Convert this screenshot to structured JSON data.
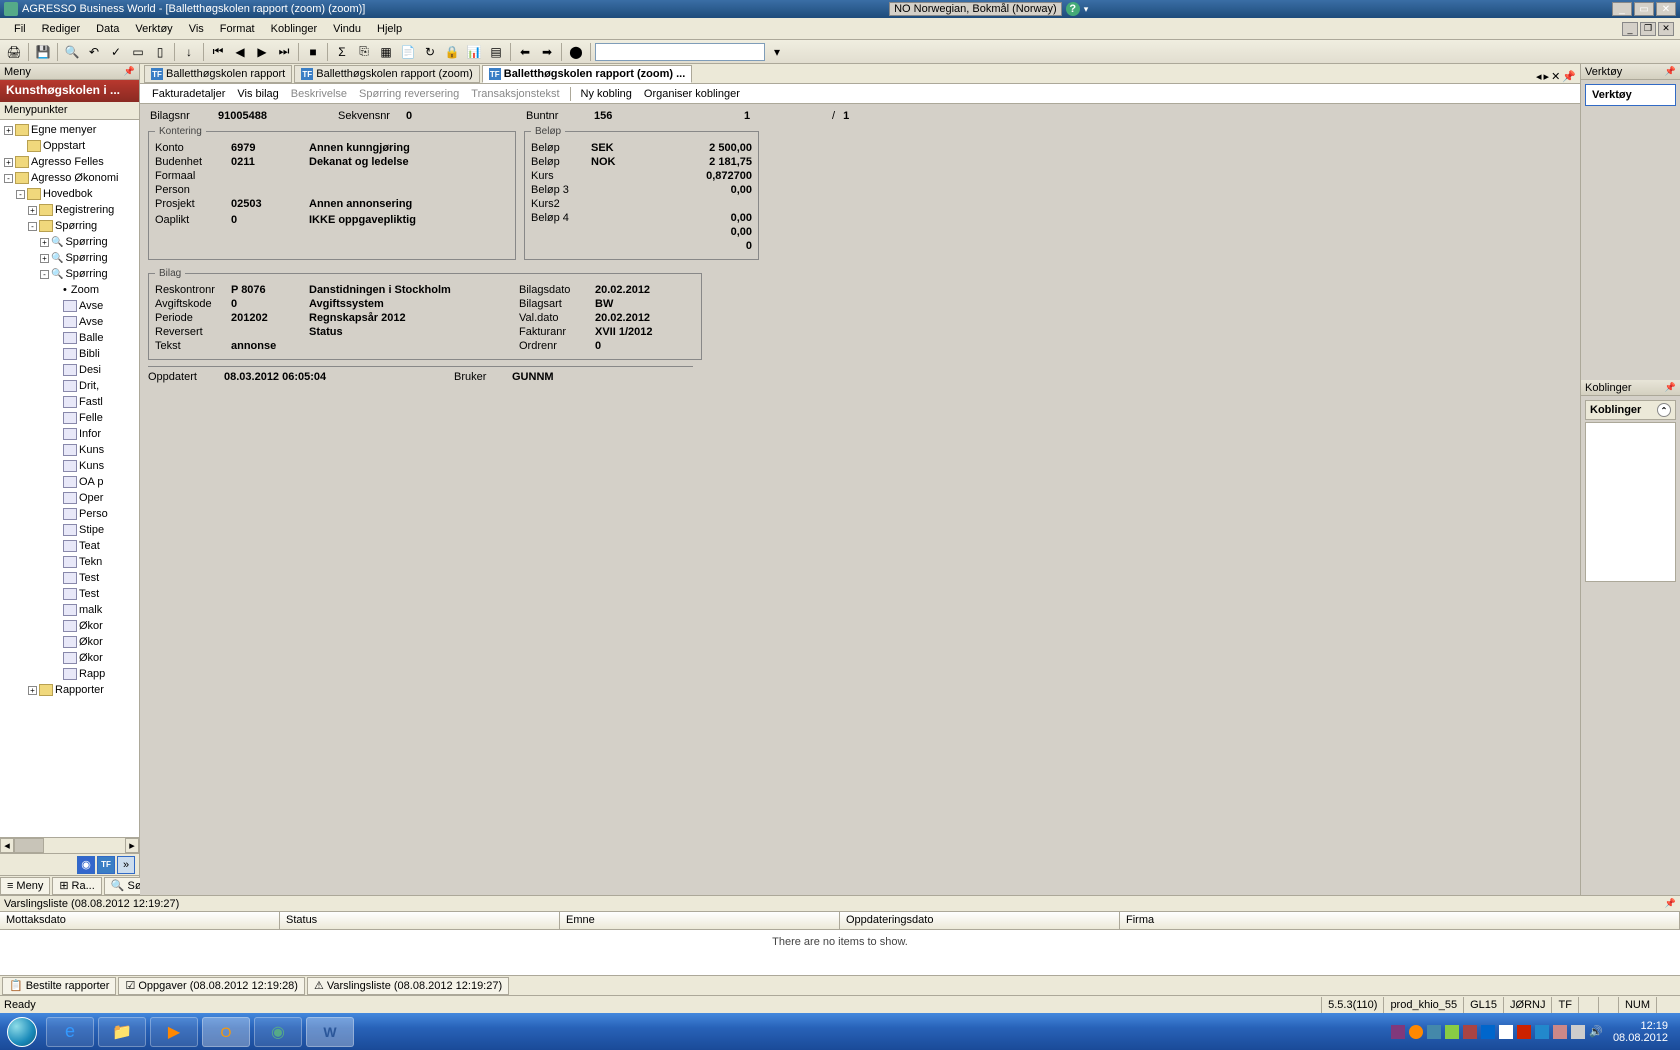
{
  "titlebar": {
    "app_title": "AGRESSO Business World - [Balletthøgskolen rapport (zoom) (zoom)]",
    "locale_code": "NO",
    "locale_name": "Norwegian, Bokmål (Norway)"
  },
  "menubar": {
    "items": [
      "Fil",
      "Rediger",
      "Data",
      "Verktøy",
      "Vis",
      "Format",
      "Koblinger",
      "Vindu",
      "Hjelp"
    ]
  },
  "left": {
    "panel_title": "Meny",
    "brand": "Kunsthøgskolen i ...",
    "subheader": "Menypunkter",
    "tree": [
      {
        "lvl": 0,
        "toggle": "+",
        "icon": "folder",
        "label": "Egne menyer"
      },
      {
        "lvl": 1,
        "toggle": "",
        "icon": "folder",
        "label": "Oppstart"
      },
      {
        "lvl": 0,
        "toggle": "+",
        "icon": "folder",
        "label": "Agresso Felles"
      },
      {
        "lvl": 0,
        "toggle": "-",
        "icon": "folder-open",
        "label": "Agresso Økonomi"
      },
      {
        "lvl": 1,
        "toggle": "-",
        "icon": "folder-open",
        "label": "Hovedbok"
      },
      {
        "lvl": 2,
        "toggle": "+",
        "icon": "folder",
        "label": "Registrering"
      },
      {
        "lvl": 2,
        "toggle": "-",
        "icon": "folder-open",
        "label": "Spørring"
      },
      {
        "lvl": 3,
        "toggle": "+",
        "icon": "mag",
        "label": "Spørring"
      },
      {
        "lvl": 3,
        "toggle": "+",
        "icon": "mag",
        "label": "Spørring"
      },
      {
        "lvl": 3,
        "toggle": "-",
        "icon": "mag",
        "label": "Spørring"
      },
      {
        "lvl": 4,
        "toggle": "",
        "icon": "bullet",
        "label": "Zoom",
        "selected": false
      },
      {
        "lvl": 4,
        "toggle": "",
        "icon": "doc",
        "label": "Avse"
      },
      {
        "lvl": 4,
        "toggle": "",
        "icon": "doc",
        "label": "Avse"
      },
      {
        "lvl": 4,
        "toggle": "",
        "icon": "doc",
        "label": "Balle"
      },
      {
        "lvl": 4,
        "toggle": "",
        "icon": "doc",
        "label": "Bibli"
      },
      {
        "lvl": 4,
        "toggle": "",
        "icon": "doc",
        "label": "Desi"
      },
      {
        "lvl": 4,
        "toggle": "",
        "icon": "doc",
        "label": "Drit,"
      },
      {
        "lvl": 4,
        "toggle": "",
        "icon": "doc",
        "label": "Fastl"
      },
      {
        "lvl": 4,
        "toggle": "",
        "icon": "doc",
        "label": "Felle"
      },
      {
        "lvl": 4,
        "toggle": "",
        "icon": "doc",
        "label": "Infor"
      },
      {
        "lvl": 4,
        "toggle": "",
        "icon": "doc",
        "label": "Kuns"
      },
      {
        "lvl": 4,
        "toggle": "",
        "icon": "doc",
        "label": "Kuns"
      },
      {
        "lvl": 4,
        "toggle": "",
        "icon": "doc",
        "label": "OA p"
      },
      {
        "lvl": 4,
        "toggle": "",
        "icon": "doc",
        "label": "Oper"
      },
      {
        "lvl": 4,
        "toggle": "",
        "icon": "doc",
        "label": "Perso"
      },
      {
        "lvl": 4,
        "toggle": "",
        "icon": "doc",
        "label": "Stipe"
      },
      {
        "lvl": 4,
        "toggle": "",
        "icon": "doc",
        "label": "Teat"
      },
      {
        "lvl": 4,
        "toggle": "",
        "icon": "doc",
        "label": "Tekn"
      },
      {
        "lvl": 4,
        "toggle": "",
        "icon": "doc",
        "label": "Test"
      },
      {
        "lvl": 4,
        "toggle": "",
        "icon": "doc",
        "label": "Test"
      },
      {
        "lvl": 4,
        "toggle": "",
        "icon": "doc",
        "label": "malk"
      },
      {
        "lvl": 4,
        "toggle": "",
        "icon": "doc",
        "label": "Økor"
      },
      {
        "lvl": 4,
        "toggle": "",
        "icon": "doc",
        "label": "Økor"
      },
      {
        "lvl": 4,
        "toggle": "",
        "icon": "doc",
        "label": "Økor"
      },
      {
        "lvl": 4,
        "toggle": "",
        "icon": "doc",
        "label": "Rapp"
      },
      {
        "lvl": 2,
        "toggle": "+",
        "icon": "folder",
        "label": "Rapporter"
      }
    ],
    "bottom_tabs": [
      {
        "icon": "≡",
        "label": "Meny"
      },
      {
        "icon": "⊞",
        "label": "Ra..."
      },
      {
        "icon": "🔍",
        "label": "Søk"
      }
    ]
  },
  "doctabs": [
    {
      "label": "Balletthøgskolen rapport",
      "active": false
    },
    {
      "label": "Balletthøgskolen rapport (zoom)",
      "active": false
    },
    {
      "label": "Balletthøgskolen rapport (zoom) ...",
      "active": true
    }
  ],
  "subtabs": {
    "group1": [
      {
        "label": "Fakturadetaljer",
        "enabled": true
      },
      {
        "label": "Vis bilag",
        "enabled": true
      },
      {
        "label": "Beskrivelse",
        "enabled": false
      },
      {
        "label": "Spørring reversering",
        "enabled": false
      },
      {
        "label": "Transaksjonstekst",
        "enabled": false
      }
    ],
    "group2": [
      {
        "label": "Ny kobling",
        "enabled": true
      },
      {
        "label": "Organiser koblinger",
        "enabled": true
      }
    ]
  },
  "form": {
    "top": {
      "bilagsnr_label": "Bilagsnr",
      "bilagsnr": "91005488",
      "sekvensnr_label": "Sekvensnr",
      "sekvensnr": "0",
      "buntnr_label": "Buntnr",
      "buntnr": "156",
      "page_cur": "1",
      "page_sep": "/",
      "page_tot": "1"
    },
    "kontering": {
      "legend": "Kontering",
      "rows": [
        {
          "label": "Konto",
          "v1": "6979",
          "v2": "Annen kunngjøring"
        },
        {
          "label": "Budenhet",
          "v1": "0211",
          "v2": "Dekanat og ledelse"
        },
        {
          "label": "Formaal",
          "v1": "",
          "v2": ""
        },
        {
          "label": "Person",
          "v1": "",
          "v2": ""
        },
        {
          "label": "Prosjekt",
          "v1": "02503",
          "v2": "Annen annonsering"
        },
        {
          "label": "",
          "v1": "",
          "v2": ""
        },
        {
          "label": "Oaplikt",
          "v1": "0",
          "v2": "IKKE oppgavepliktig"
        }
      ]
    },
    "belop": {
      "legend": "Beløp",
      "rows": [
        {
          "label": "Beløp",
          "cur": "SEK",
          "amt": "2 500,00"
        },
        {
          "label": "Beløp",
          "cur": "NOK",
          "amt": "2 181,75"
        },
        {
          "label": "Kurs",
          "cur": "",
          "amt": "0,872700"
        },
        {
          "label": "Beløp 3",
          "cur": "",
          "amt": "0,00"
        },
        {
          "label": "Kurs2",
          "cur": "",
          "amt": ""
        },
        {
          "label": "Beløp 4",
          "cur": "",
          "amt": "0,00"
        },
        {
          "label": "",
          "cur": "",
          "amt": "0,00"
        },
        {
          "label": "",
          "cur": "",
          "amt": "0"
        }
      ]
    },
    "bilag": {
      "legend": "Bilag",
      "rows": [
        {
          "l1": "Reskontronr",
          "v1": "P   8076",
          "v1b": "Danstidningen i Stockholm",
          "l2": "Bilagsdato",
          "v2": "20.02.2012"
        },
        {
          "l1": "Avgiftskode",
          "v1": "0",
          "v1b": "Avgiftssystem",
          "l2": "Bilagsart",
          "v2": "BW"
        },
        {
          "l1": "Periode",
          "v1": "201202",
          "v1b": "Regnskapsår    2012",
          "l2": "Val.dato",
          "v2": "20.02.2012"
        },
        {
          "l1": "Reversert",
          "v1": "",
          "v1b": "Status",
          "l2": "Fakturanr",
          "v2": "XVII 1/2012"
        },
        {
          "l1": "Tekst",
          "v1": "annonse",
          "v1b": "",
          "l2": "Ordrenr",
          "v2": "0"
        }
      ]
    },
    "footer": {
      "oppdatert_label": "Oppdatert",
      "oppdatert": "08.03.2012 06:05:04",
      "bruker_label": "Bruker",
      "bruker": "GUNNM"
    }
  },
  "right": {
    "verktoy_title": "Verktøy",
    "verktoy_box": "Verktøy",
    "koblinger_title": "Koblinger",
    "koblinger_box": "Koblinger"
  },
  "alerts": {
    "title": "Varslingsliste (08.08.2012 12:19:27)",
    "cols": [
      "Mottaksdato",
      "Status",
      "Emne",
      "Oppdateringsdato",
      "Firma"
    ],
    "empty": "There are no items to show.",
    "tabs": [
      {
        "label": "Bestilte rapporter"
      },
      {
        "label": "Oppgaver (08.08.2012 12:19:28)"
      },
      {
        "label": "Varslingsliste (08.08.2012 12:19:27)"
      }
    ]
  },
  "status": {
    "ready": "Ready",
    "cells": [
      "5.5.3(110)",
      "prod_khio_55",
      "GL15",
      "JØRNJ",
      "TF",
      "",
      "",
      "NUM",
      ""
    ]
  },
  "taskbar": {
    "clock_time": "12:19",
    "clock_date": "08.08.2012"
  }
}
